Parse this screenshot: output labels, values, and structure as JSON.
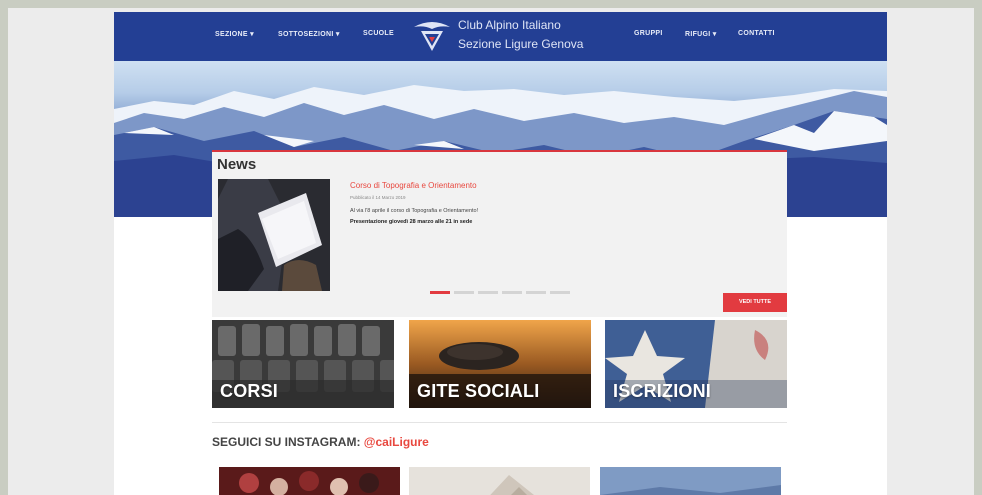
{
  "header": {
    "nav_left": [
      "SEZIONE ▾",
      "SOTTOSEZIONI ▾",
      "SCUOLE"
    ],
    "nav_right": [
      "GRUPPI",
      "RIFUGI ▾",
      "CONTATTI"
    ],
    "logo_line1": "Club Alpino Italiano",
    "logo_line2": "Sezione Ligure Genova",
    "color": "#233f94"
  },
  "news": {
    "title": "News",
    "headline": "Corso di Topografia e Orientamento",
    "date": "Pubblicato il 14 Marzo 2019",
    "text1": "Al via l'8 aprile il corso di Topografia e Orientamento!",
    "text2": "Presentazione giovedì 28 marzo alle 21 in sede",
    "slides": 6,
    "active_slide": 1,
    "button": "VEDI TUTTE",
    "accent": "#e23b40"
  },
  "cards": [
    "CORSI",
    "GITE SOCIALI",
    "ISCRIZIONI"
  ],
  "instagram": {
    "title": "SEGUICI SU INSTAGRAM: ",
    "handle": "@caiLigure"
  }
}
